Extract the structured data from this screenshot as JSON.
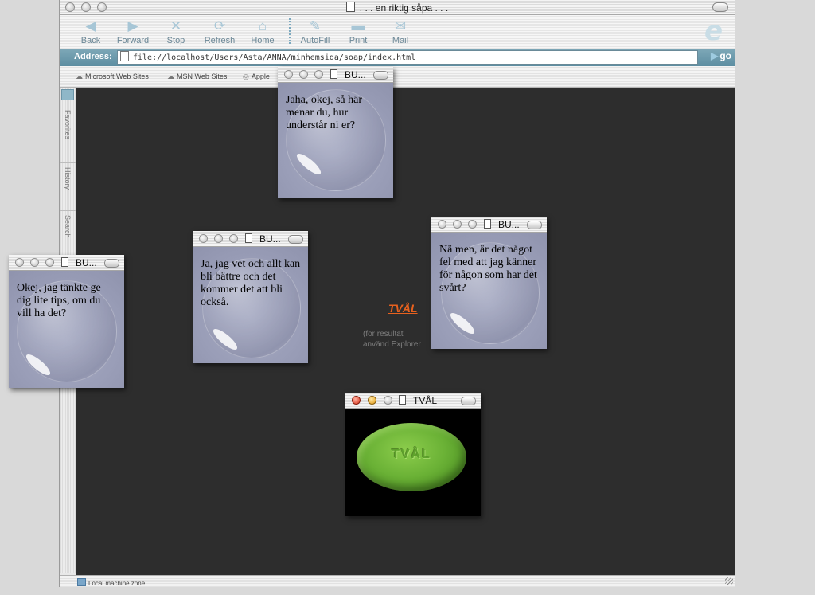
{
  "window": {
    "title": ". . . en riktig såpa . . ."
  },
  "toolbar": {
    "back": "Back",
    "forward": "Forward",
    "stop": "Stop",
    "refresh": "Refresh",
    "home": "Home",
    "autofill": "AutoFill",
    "print": "Print",
    "mail": "Mail"
  },
  "address": {
    "label": "Address:",
    "url": "file://localhost/Users/Asta/ANNA/minhemsida/soap/index.html",
    "go": "go"
  },
  "favorites": [
    "Microsoft Web Sites",
    "MSN Web Sites",
    "Apple"
  ],
  "sidebar": {
    "tabs": [
      "Favorites",
      "History",
      "Search"
    ]
  },
  "page": {
    "link": "TVÅL",
    "hint_line1": "(för resultat",
    "hint_line2": "använd Explorer"
  },
  "popups": [
    {
      "title": "BU...",
      "text": "Jaha, okej, så här menar du, hur understår ni er?"
    },
    {
      "title": "BU...",
      "text": "Ja, jag vet och allt kan bli bättre och det kommer det att bli också."
    },
    {
      "title": "BU...",
      "text": "Nä men, är det något fel med att jag känner för någon som har det svårt?"
    },
    {
      "title": "BU...",
      "text": "Okej, jag tänkte ge dig lite tips, om du vill ha det?"
    }
  ],
  "soap_window": {
    "title": "TVÅL",
    "soap_text": "TVÅL"
  },
  "status": {
    "zone": "Local machine zone"
  },
  "colors": {
    "link": "#e8611e",
    "content_bg": "#2d2d2d",
    "address_bar": "#6e9cae",
    "soap": "#6bb236"
  }
}
